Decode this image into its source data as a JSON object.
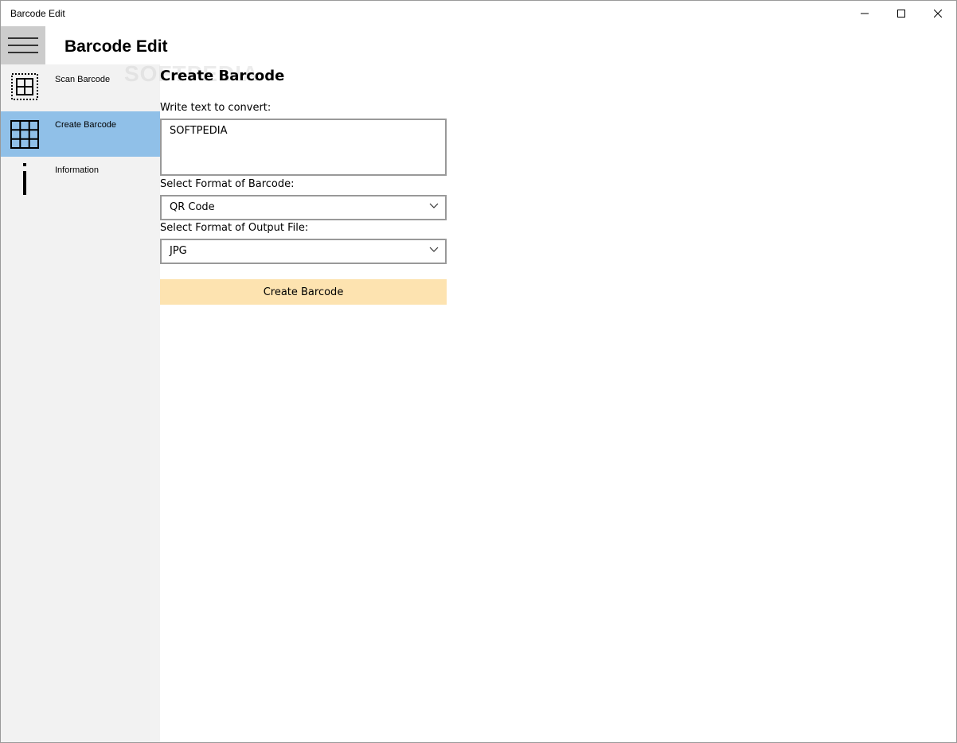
{
  "window": {
    "title": "Barcode Edit"
  },
  "header": {
    "app_title": "Barcode Edit",
    "menu_icon": "hamburger-menu-icon"
  },
  "watermark": "SOFTPEDIA",
  "sidebar": {
    "items": [
      {
        "label": "Scan Barcode",
        "icon": "scan-barcode-icon",
        "selected": false
      },
      {
        "label": "Create Barcode",
        "icon": "grid-barcode-icon",
        "selected": true
      },
      {
        "label": "Information",
        "icon": "info-icon",
        "selected": false
      }
    ],
    "selected_color": "#90c0e8",
    "background_color": "#f2f2f2"
  },
  "main": {
    "page_title": "Create Barcode",
    "text_label": "Write text to convert:",
    "text_value": "SOFTPEDIA",
    "barcode_format_label": "Select Format of Barcode:",
    "barcode_format_value": "QR Code",
    "output_format_label": "Select Format of Output File:",
    "output_format_value": "JPG",
    "create_button_label": "Create Barcode",
    "create_button_color": "#fde3b0"
  }
}
